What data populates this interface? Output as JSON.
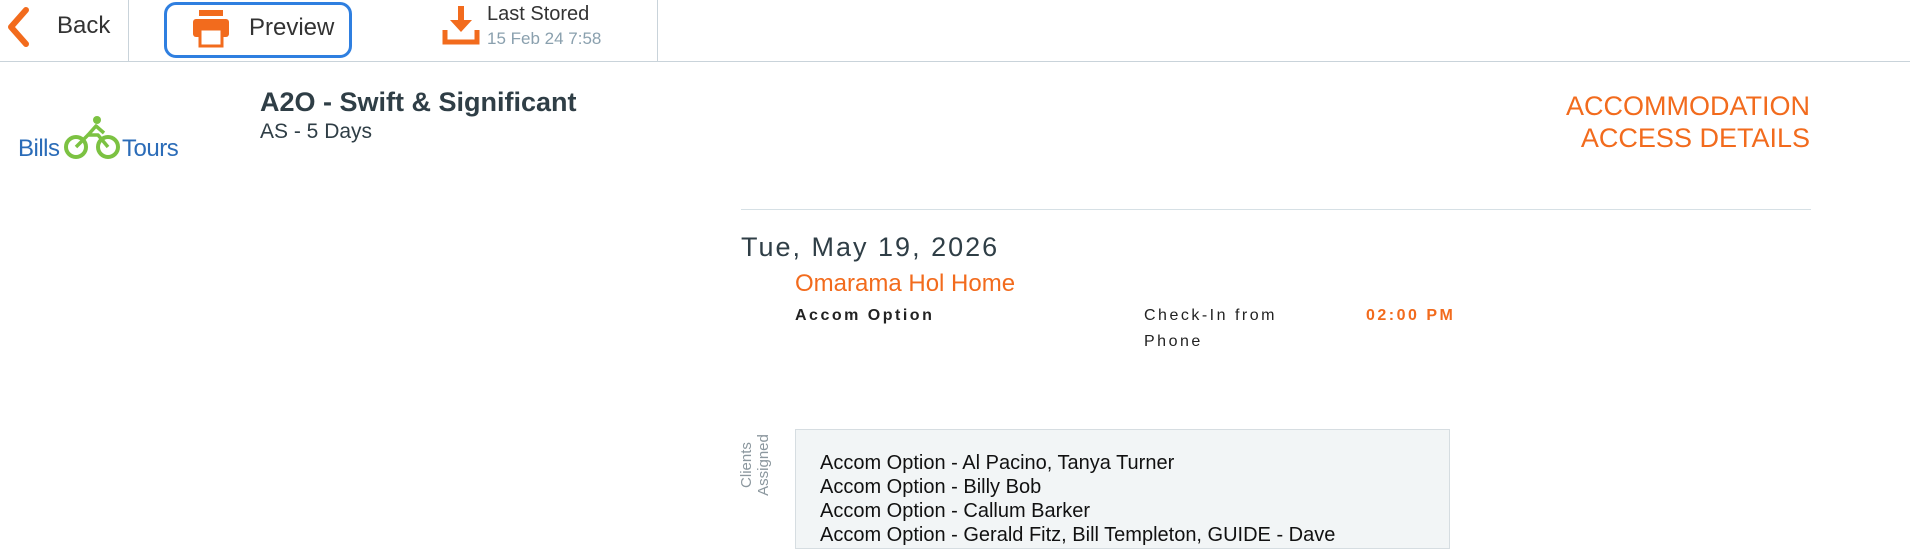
{
  "toolbar": {
    "back_label": "Back",
    "preview_label": "Preview",
    "last_stored_title": "Last Stored",
    "last_stored_value": "15 Feb 24 7:58",
    "icons": {
      "back": "chevron-left-icon",
      "preview": "printer-icon",
      "stored": "download-icon"
    }
  },
  "logo": {
    "word1": "Bills",
    "word2": "Tours"
  },
  "trip": {
    "title": "A2O - Swift & Significant",
    "subtitle": "AS - 5 Days"
  },
  "document": {
    "title_line1": "ACCOMMODATION",
    "title_line2": "ACCESS DETAILS"
  },
  "entry": {
    "date": "Tue, May 19, 2026",
    "accommodation": "Omarama Hol Home",
    "option_label": "Accom Option",
    "checkin_label": "Check-In from",
    "checkin_time": "02:00 PM",
    "phone_label": "Phone",
    "clients_label_line1": "Clients",
    "clients_label_line2": "Assigned",
    "clients": [
      "Accom Option - Al Pacino, Tanya Turner",
      "Accom Option - Billy Bob",
      "Accom Option - Callum Barker",
      "Accom Option - Gerald Fitz, Bill Templeton, GUIDE - Dave"
    ]
  },
  "colors": {
    "accent": "#f26b1d",
    "focus": "#2f7fe0",
    "brand_blue": "#2b6cb8",
    "brand_green": "#7cc242",
    "text_dark": "#2f3e46"
  }
}
